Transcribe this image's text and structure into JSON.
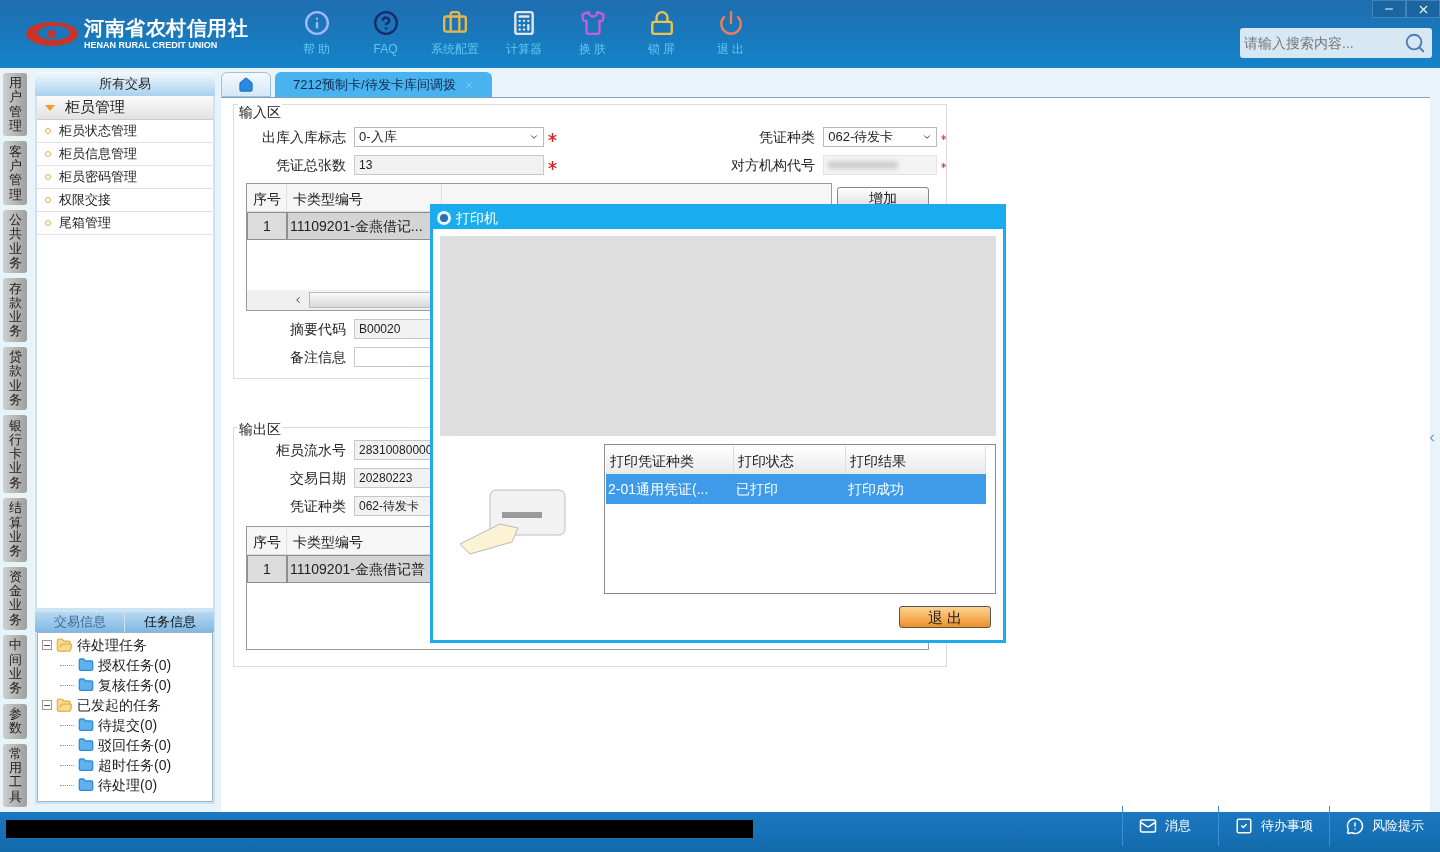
{
  "header": {
    "logo_cn": "河南省农村信用社",
    "logo_en": "HENAN RURAL CREDIT UNION",
    "toolbar": [
      {
        "label": "帮 助",
        "kind": "info"
      },
      {
        "label": "FAQ",
        "kind": "help"
      },
      {
        "label": "系统配置",
        "kind": "config"
      },
      {
        "label": "计算器",
        "kind": "calculator"
      },
      {
        "label": "换 肤",
        "kind": "skin"
      },
      {
        "label": "锁 屏",
        "kind": "lock"
      },
      {
        "label": "退 出",
        "kind": "exit"
      }
    ],
    "search": {
      "placeholder": "请输入搜索内容..."
    }
  },
  "side_tabs": [
    "用户管理",
    "客户管理",
    "公共业务",
    "存款业务",
    "贷款业务",
    "银行卡业务",
    "结算业务",
    "资金业务",
    "中间业务",
    "参数",
    "常用工具"
  ],
  "sidebar": {
    "title": "所有交易",
    "group": {
      "label": "柜员管理",
      "expanded": true,
      "items": [
        "柜员状态管理",
        "柜员信息管理",
        "柜员密码管理",
        "权限交接",
        "尾箱管理"
      ]
    },
    "info_tabs": [
      {
        "label": "交易信息",
        "selected": false
      },
      {
        "label": "任务信息",
        "selected": true
      }
    ],
    "tree": [
      {
        "label": "待处理任务",
        "expanded": true,
        "children": [
          {
            "label": "授权任务(0)"
          },
          {
            "label": "复核任务(0)"
          }
        ]
      },
      {
        "label": "已发起的任务",
        "expanded": true,
        "children": [
          {
            "label": "待提交(0)"
          },
          {
            "label": "驳回任务(0)"
          },
          {
            "label": "超时任务(0)"
          },
          {
            "label": "待处理(0)"
          }
        ]
      }
    ]
  },
  "tabs": [
    {
      "kind": "home",
      "selected": false
    },
    {
      "kind": "page",
      "label": "7212预制卡/待发卡库间调拨",
      "selected": true
    }
  ],
  "input_section": {
    "title": "输入区",
    "fields": [
      {
        "label": "出库入库标志",
        "value": "0-入库",
        "kind": "select",
        "required": true
      },
      {
        "label": "凭证种类",
        "value": "062-待发卡",
        "kind": "select",
        "required": true
      },
      {
        "label": "凭证总张数",
        "value": "13",
        "kind": "text",
        "required": true
      },
      {
        "label": "对方机构代号",
        "kind": "blurred",
        "required": true
      }
    ],
    "grid": {
      "columns": [
        "序号",
        "卡类型编号"
      ],
      "rows": [
        [
          "1",
          "11109201-金燕借记..."
        ]
      ]
    },
    "add_button": "增加",
    "extra_fields": [
      {
        "label": "摘要代码",
        "value": "B00020"
      },
      {
        "label": "备注信息"
      }
    ]
  },
  "output_section": {
    "title": "输出区",
    "fields": [
      {
        "label": "柜员流水号",
        "value": "28310080000"
      },
      {
        "label": "交易日期",
        "value": "20280223"
      },
      {
        "label": "凭证种类",
        "value": "062-待发卡"
      }
    ],
    "grid": {
      "columns": [
        "序号",
        "卡类型编号"
      ],
      "rows": [
        [
          "1",
          "11109201-金燕借记普"
        ]
      ]
    }
  },
  "dialog": {
    "title": "打印机",
    "columns": [
      "打印凭证种类",
      "打印状态",
      "打印结果"
    ],
    "rows": [
      {
        "cells": [
          "2-01通用凭证(...",
          "已打印",
          "打印成功"
        ],
        "selected": true
      }
    ],
    "button": "退 出"
  },
  "status_bar": [
    {
      "label": "消息",
      "kind": "mail"
    },
    {
      "label": "待办事项",
      "kind": "todo"
    },
    {
      "label": "风险提示",
      "kind": "alert"
    }
  ]
}
